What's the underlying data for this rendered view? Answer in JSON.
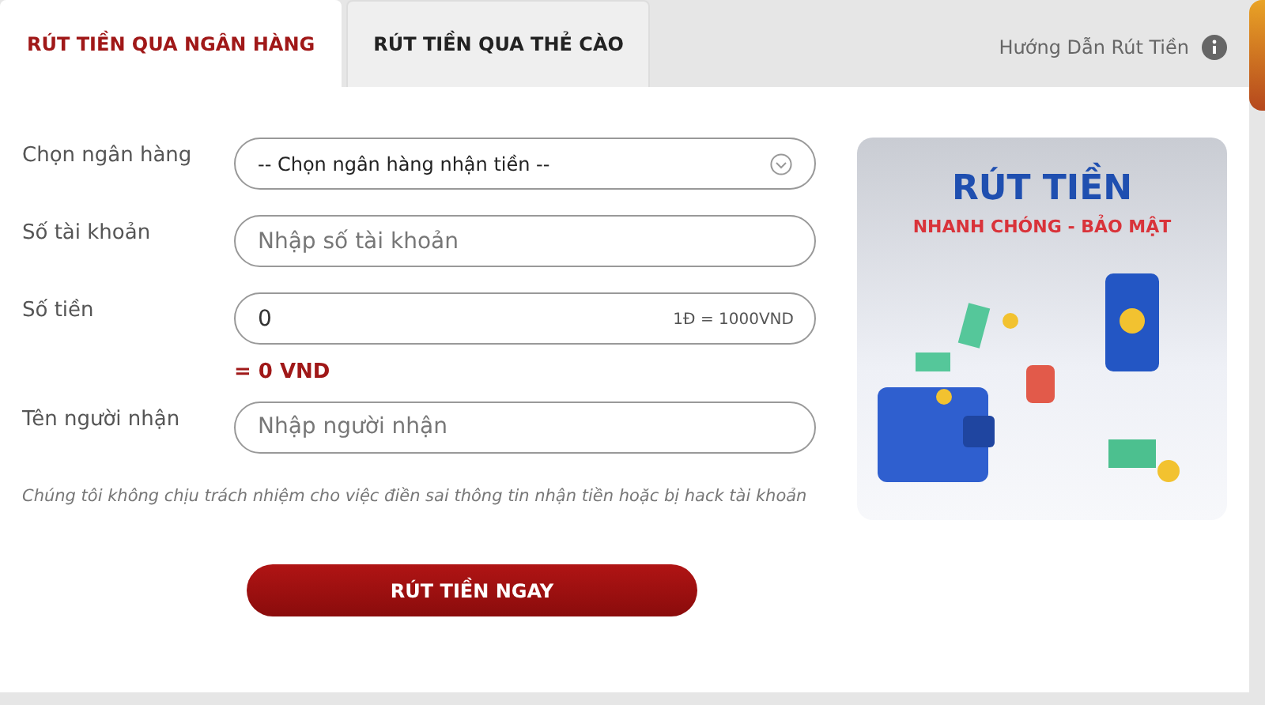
{
  "tabs": [
    {
      "label": "RÚT TIỀN QUA NGÂN HÀNG",
      "selected": true
    },
    {
      "label": "RÚT TIỀN QUA THẺ CÀO",
      "selected": false
    }
  ],
  "help_link": "Hướng Dẫn Rút Tiền",
  "form": [
    {
      "kind": "select",
      "label": "Chọn ngân hàng",
      "value": "-- Chọn ngân hàng nhận tiền --"
    },
    {
      "kind": "input",
      "label": "Số tài khoản",
      "placeholder": "Nhập số tài khoản"
    },
    {
      "kind": "amount",
      "label": "Số tiền",
      "value": "0",
      "rate": "1Đ = 1000VND",
      "converted": "= 0 VND"
    },
    {
      "kind": "input",
      "label": "Tên người nhận",
      "placeholder": "Nhập người nhận"
    }
  ],
  "disclaimer": "Chúng tôi không chịu trách nhiệm cho việc điền sai thông tin nhận tiền hoặc bị hack tài khoản",
  "submit_button": "RÚT TIỀN NGAY",
  "banner": {
    "title": "RÚT TIỀN",
    "subtitle": "NHANH CHÓNG - BẢO MẬT"
  }
}
